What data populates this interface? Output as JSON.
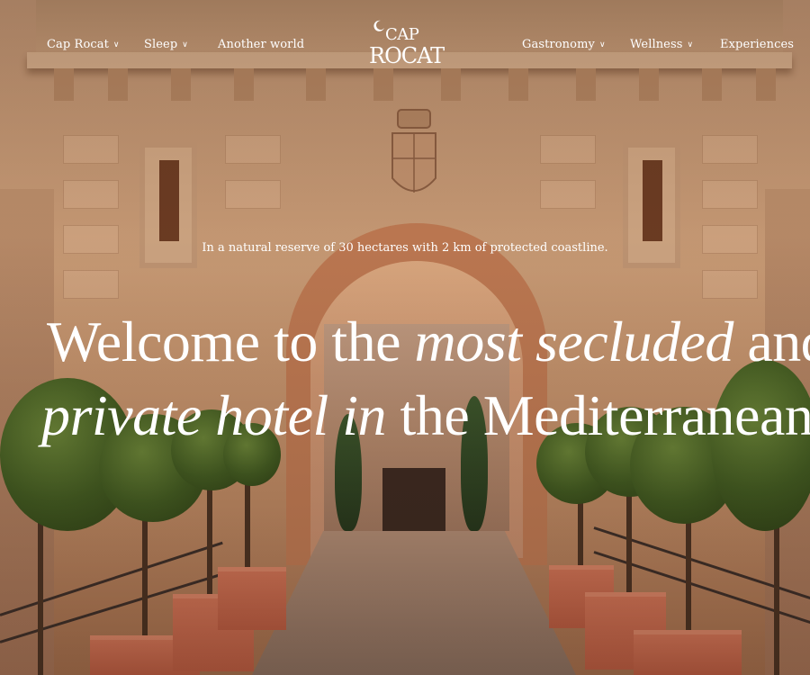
{
  "nav": {
    "left": [
      {
        "label": "Cap Rocat",
        "dropdown": true
      },
      {
        "label": "Sleep",
        "dropdown": true
      },
      {
        "label": "Another world",
        "dropdown": false
      }
    ],
    "right": [
      {
        "label": "Gastronomy",
        "dropdown": true
      },
      {
        "label": "Wellness",
        "dropdown": true
      },
      {
        "label": "Experiences",
        "dropdown": false
      }
    ],
    "chevron_glyph": "∨",
    "logo": {
      "line1": "CAP",
      "line2": "ROCAT",
      "icon": "crescent-moon-icon"
    }
  },
  "hero": {
    "tagline": "In a natural reserve of 30 hectares with 2 km of protected coastline.",
    "headline": {
      "line1_a": "Welcome to the ",
      "line1_italic": "most secluded",
      "line1_b": " and",
      "line2_italic": "private hotel in",
      "line2_b": " the Mediterranean."
    }
  },
  "colors": {
    "text": "#ffffff",
    "stone": "#d3a57e",
    "terracotta": "#c15f44",
    "foliage": "#3f5e22"
  }
}
